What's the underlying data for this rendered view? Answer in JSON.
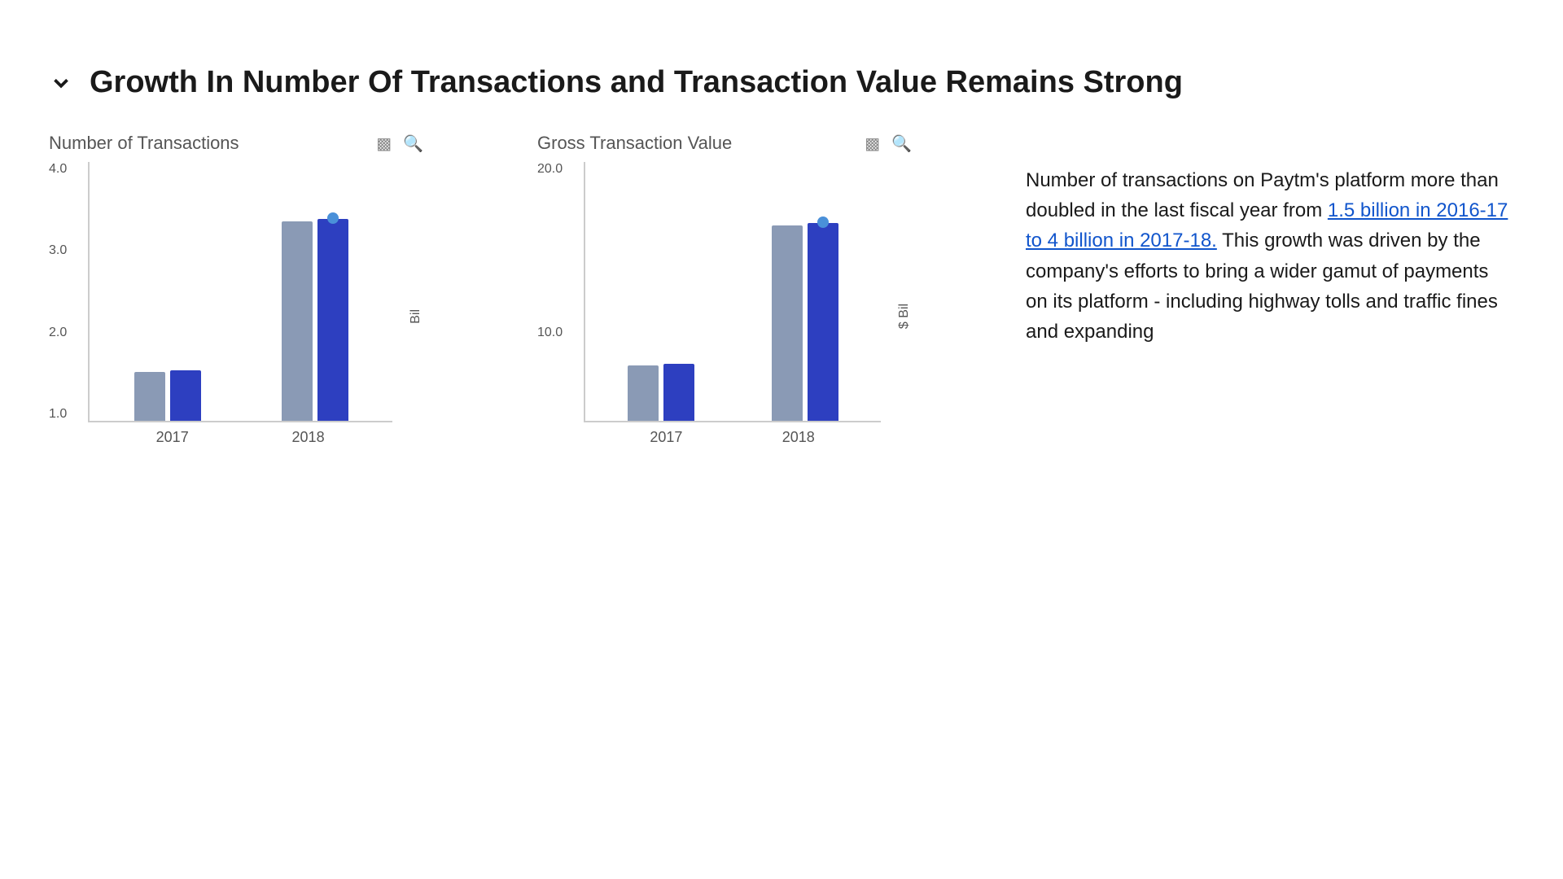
{
  "section": {
    "title": "Growth In Number Of Transactions and Transaction Value Remains Strong"
  },
  "chart1": {
    "title": "Number of Transactions",
    "y_labels": [
      "4.0",
      "3.0",
      "2.0",
      "1.0"
    ],
    "y_axis_label": "Bil",
    "x_labels": [
      "2017",
      "2018"
    ],
    "bar_groups": [
      {
        "year": "2017",
        "gray_height": 60,
        "blue_height": 62,
        "dot": false
      },
      {
        "year": "2018",
        "gray_height": 245,
        "blue_height": 248,
        "dot": true
      }
    ]
  },
  "chart2": {
    "title": "Gross Transaction Value",
    "y_labels": [
      "20.0",
      "",
      "10.0",
      ""
    ],
    "y_axis_label": "$ Bil",
    "x_labels": [
      "2017",
      "2018"
    ],
    "bar_groups": [
      {
        "year": "2017",
        "gray_height": 68,
        "blue_height": 70,
        "dot": false
      },
      {
        "year": "2018",
        "gray_height": 240,
        "blue_height": 243,
        "dot": true
      }
    ]
  },
  "description": {
    "text_before": "Number of transactions on Paytm's platform more than doubled in the last fiscal year from ",
    "link_text": "1.5 billion in 2016-17 to 4 billion in 2017-18.",
    "text_after": " This growth was driven by the company's efforts to bring a wider gamut of payments on its platform - including highway tolls and traffic fines and expanding"
  }
}
